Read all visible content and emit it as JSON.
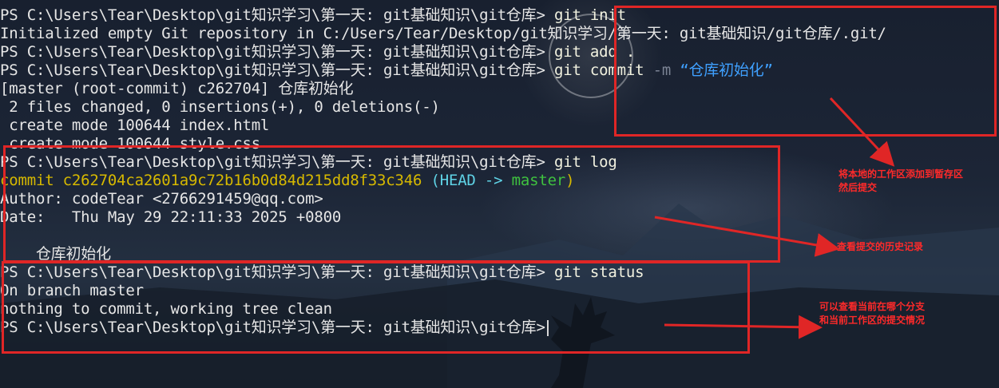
{
  "terminal": {
    "lines": [
      {
        "prompt": "PS C:\\Users\\Tear\\Desktop\\git知识学习\\第一天: git基础知识\\git仓库>",
        "cmd": " git init"
      },
      {
        "text": "Initialized empty Git repository in C:/Users/Tear/Desktop/git知识学习/第一天: git基础知识/git仓库/.git/"
      },
      {
        "prompt": "PS C:\\Users\\Tear\\Desktop\\git知识学习\\第一天: git基础知识\\git仓库>",
        "cmd": " git add ."
      },
      {
        "prompt": "PS C:\\Users\\Tear\\Desktop\\git知识学习\\第一天: git基础知识\\git仓库>",
        "cmd": " git commit",
        "flag": " -m",
        "str": " “仓库初始化”"
      },
      {
        "text": "[master (root-commit) c262704] 仓库初始化"
      },
      {
        "text": " 2 files changed, 0 insertions(+), 0 deletions(-)"
      },
      {
        "text": " create mode 100644 index.html"
      },
      {
        "text": " create mode 100644 style.css"
      },
      {
        "prompt": "PS C:\\Users\\Tear\\Desktop\\git知识学习\\第一天: git基础知识\\git仓库>",
        "cmd": " git log"
      },
      {
        "commit_prefix": "commit c262704ca2601a9c72b16b0d84d215dd8f33c346",
        "head": " (HEAD ->",
        "branch": " master",
        "close": ")"
      },
      {
        "text": "Author: codeTear <2766291459@qq.com>"
      },
      {
        "text": "Date:   Thu May 29 22:11:33 2025 +0800"
      },
      {
        "text": ""
      },
      {
        "text": "    仓库初始化"
      },
      {
        "prompt": "PS C:\\Users\\Tear\\Desktop\\git知识学习\\第一天: git基础知识\\git仓库>",
        "cmd": " git status"
      },
      {
        "text": "On branch master"
      },
      {
        "text": "nothing to commit, working tree clean"
      },
      {
        "prompt": "PS C:\\Users\\Tear\\Desktop\\git知识学习\\第一天: git基础知识\\git仓库>",
        "cursor": true
      }
    ]
  },
  "annotations": {
    "note1": "将本地的工作区添加到暂存区\n然后提交",
    "note2": "查看提交的历史记录",
    "note3": "可以查看当前在哪个分支\n和当前工作区的提交情况"
  },
  "colors": {
    "annotation": "#e02626",
    "command_string": "#3fa0ff",
    "commit_hash": "#d7b900",
    "head": "#5fd3e6",
    "branch": "#3fc23f"
  }
}
